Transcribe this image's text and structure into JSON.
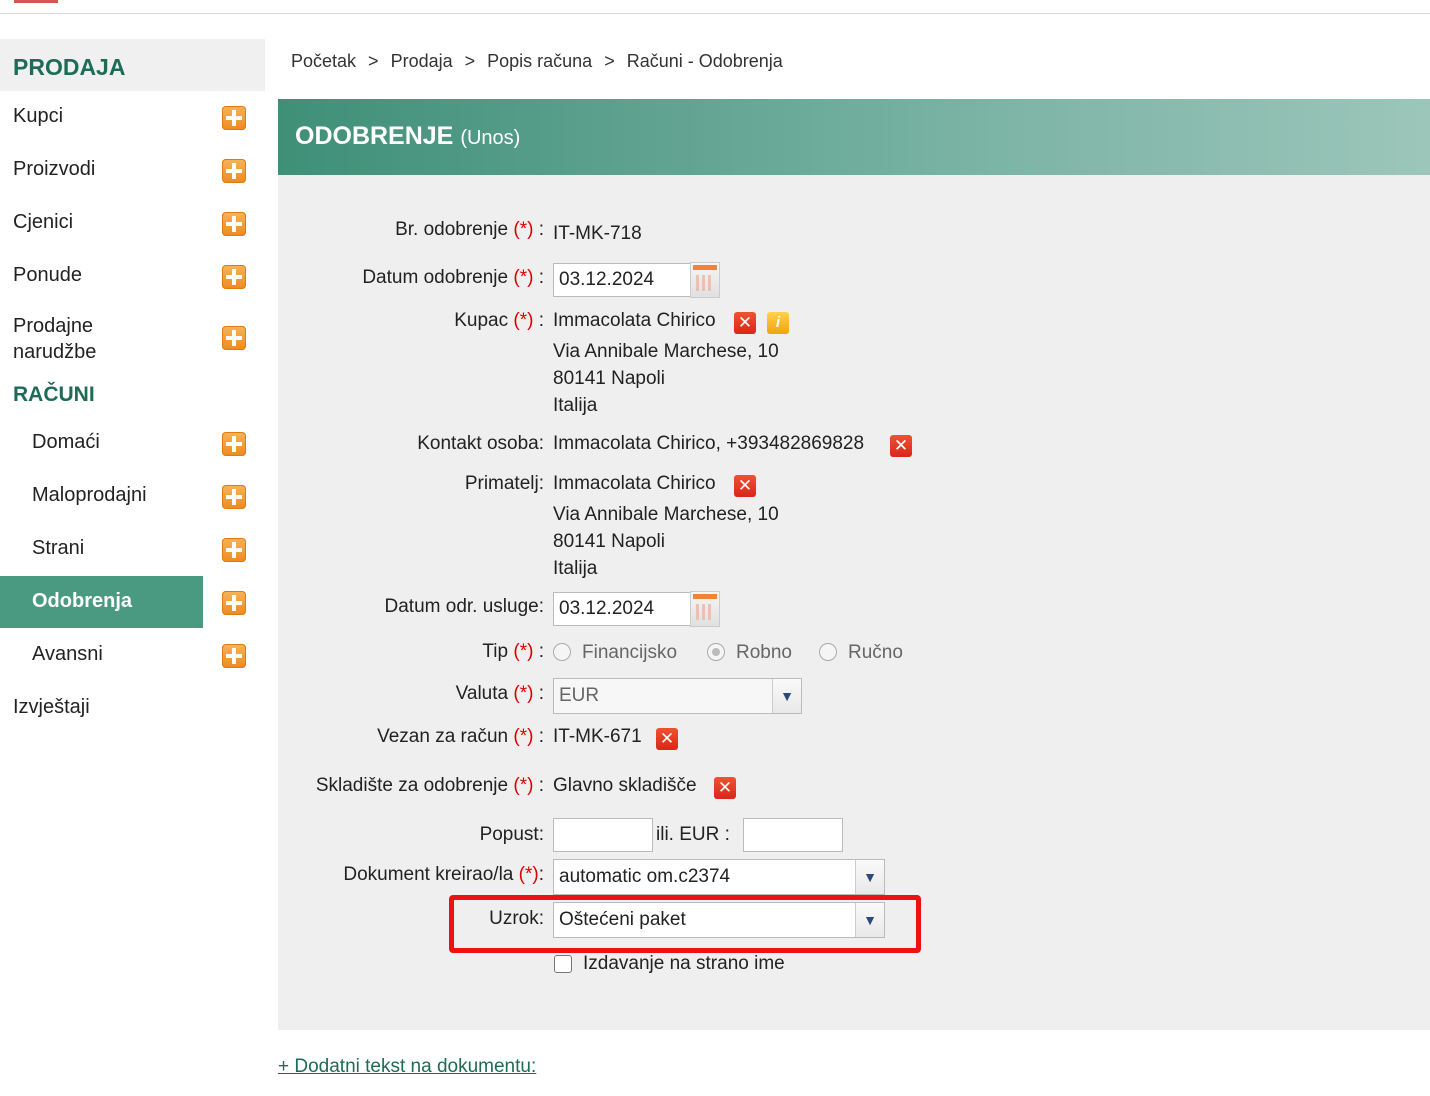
{
  "sidebar": {
    "section1": "PRODAJA",
    "items1": [
      {
        "label": "Kupci"
      },
      {
        "label": "Proizvodi"
      },
      {
        "label": "Cjenici"
      },
      {
        "label": "Ponude"
      },
      {
        "label": "Prodajne\nnarudžbe"
      }
    ],
    "section2": "RAČUNI",
    "items2": [
      {
        "label": "Domaći"
      },
      {
        "label": "Maloprodajni"
      },
      {
        "label": "Strani"
      },
      {
        "label": "Odobrenja"
      },
      {
        "label": "Avansni"
      }
    ],
    "reports": "Izvještaji"
  },
  "breadcrumb": [
    "Početak",
    "Prodaja",
    "Popis računa",
    "Računi - Odobrenja"
  ],
  "breadcrumb_sep": ">",
  "header": {
    "title": "ODOBRENJE",
    "subtitle": "(Unos)"
  },
  "form": {
    "br_odobrenje": {
      "label": "Br. odobrenje",
      "value": "IT-MK-718"
    },
    "datum_odobrenje": {
      "label": "Datum odobrenje",
      "value": "03.12.2024"
    },
    "kupac": {
      "label": "Kupac",
      "name": "Immacolata Chirico",
      "street": "Via Annibale Marchese, 10",
      "city": "80141 Napoli",
      "country": "Italija"
    },
    "kontakt": {
      "label": "Kontakt osoba:",
      "value": "Immacolata Chirico, +393482869828"
    },
    "primatelj": {
      "label": "Primatelj:",
      "name": "Immacolata Chirico",
      "street": "Via Annibale Marchese, 10",
      "city": "80141 Napoli",
      "country": "Italija"
    },
    "datum_usluge": {
      "label": "Datum odr. usluge:",
      "value": "03.12.2024"
    },
    "tip": {
      "label": "Tip",
      "options": [
        "Financijsko",
        "Robno",
        "Ručno"
      ],
      "selected": "Robno"
    },
    "valuta": {
      "label": "Valuta",
      "value": "EUR"
    },
    "vezan": {
      "label": "Vezan za račun",
      "value": "IT-MK-671"
    },
    "skladiste": {
      "label": "Skladište za odobrenje",
      "value": "Glavno skladišče"
    },
    "popust": {
      "label": "Popust:",
      "or_label": "ili. EUR :"
    },
    "kreirao": {
      "label": "Dokument kreirao/la",
      "value": "automatic om.c2374"
    },
    "uzrok": {
      "label": "Uzrok:",
      "value": "Oštećeni paket"
    },
    "strano_ime": {
      "label": "Izdavanje na strano ime",
      "checked": false
    }
  },
  "req_mark": "(*)",
  "extra_link": "+ Dodatni tekst na dokumentu:",
  "colors": {
    "accent": "#1e6b57",
    "active": "#4a9a82",
    "highlight": "#ee1111"
  },
  "icons": {
    "add": "plus-icon",
    "remove": "close-icon",
    "info": "info-icon",
    "calendar": "calendar-icon",
    "dropdown": "chevron-down-icon"
  }
}
